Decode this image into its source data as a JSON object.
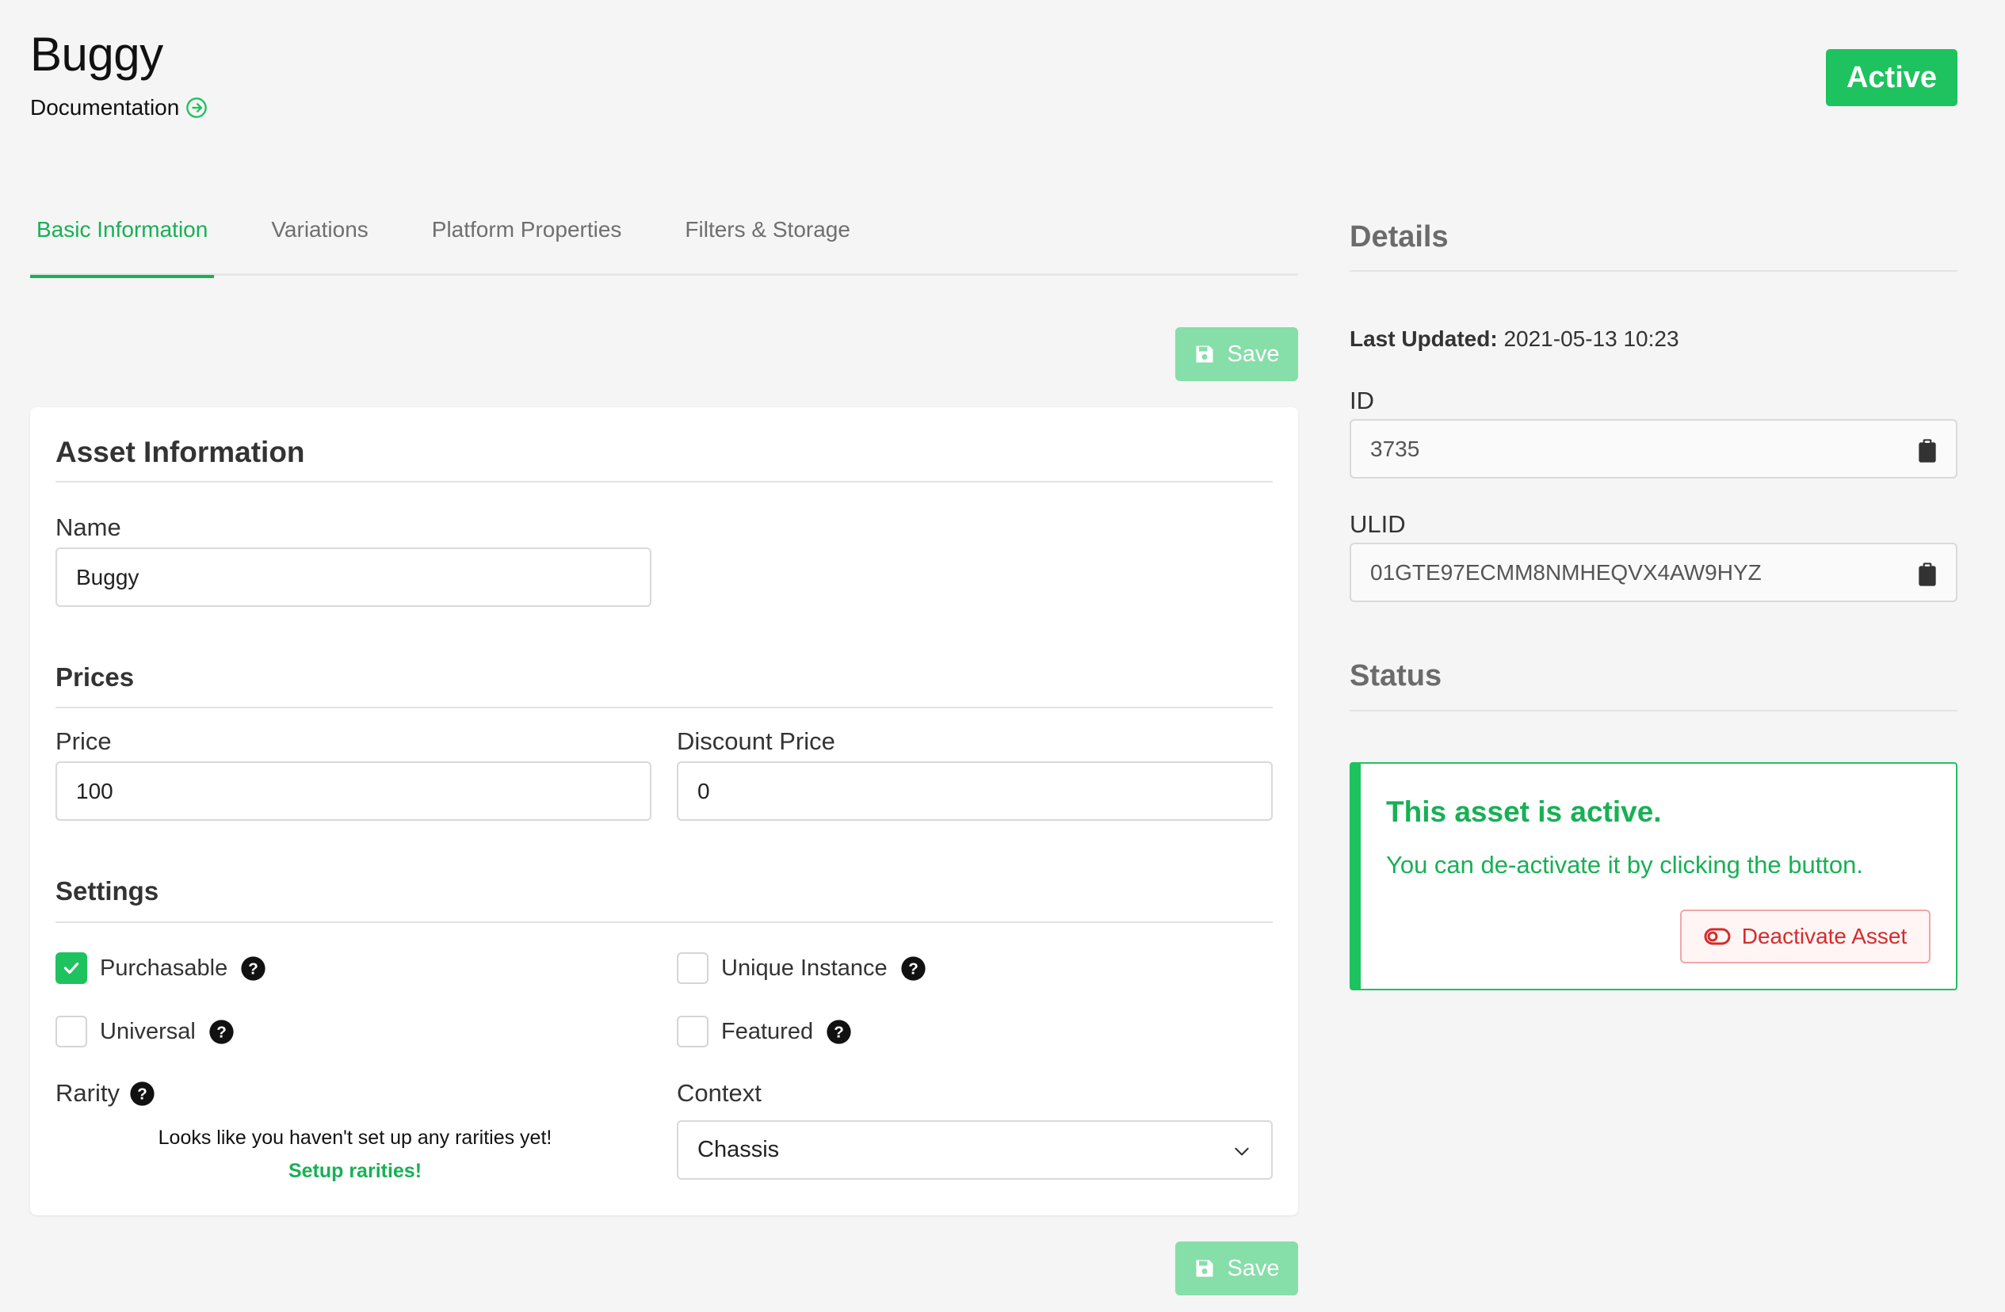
{
  "header": {
    "title": "Buggy",
    "doc_link": "Documentation",
    "status_badge": "Active",
    "accent": "#1ec25f"
  },
  "tabs": [
    {
      "label": "Basic Information",
      "active": true
    },
    {
      "label": "Variations"
    },
    {
      "label": "Platform Properties"
    },
    {
      "label": "Filters & Storage"
    }
  ],
  "toolbar": {
    "save_label": "Save"
  },
  "asset": {
    "section_title": "Asset Information",
    "name_label": "Name",
    "name_value": "Buggy",
    "prices_title": "Prices",
    "price_label": "Price",
    "price_value": "100",
    "discount_label": "Discount Price",
    "discount_value": "0",
    "settings_title": "Settings",
    "settings": {
      "purchasable": {
        "label": "Purchasable",
        "checked": true
      },
      "unique_instance": {
        "label": "Unique Instance",
        "checked": false
      },
      "universal": {
        "label": "Universal",
        "checked": false
      },
      "featured": {
        "label": "Featured",
        "checked": false
      }
    },
    "rarity_label": "Rarity",
    "rarity_empty": "Looks like you haven't set up any rarities yet!",
    "rarity_link": "Setup rarities!",
    "context_label": "Context",
    "context_value": "Chassis"
  },
  "details": {
    "heading": "Details",
    "last_updated_label": "Last Updated:",
    "last_updated_value": "2021-05-13 10:23",
    "id_label": "ID",
    "id_value": "3735",
    "ulid_label": "ULID",
    "ulid_value": "01GTE97ECMM8NMHEQVX4AW9HYZ"
  },
  "status": {
    "heading": "Status",
    "title": "This asset is active.",
    "text": "You can de-activate it by clicking the button.",
    "button": "Deactivate Asset"
  },
  "icons": [
    "circle-arrow-right-icon",
    "save-icon",
    "help-icon",
    "check-icon",
    "chevron-down-icon",
    "clipboard-icon",
    "toggle-off-icon"
  ]
}
